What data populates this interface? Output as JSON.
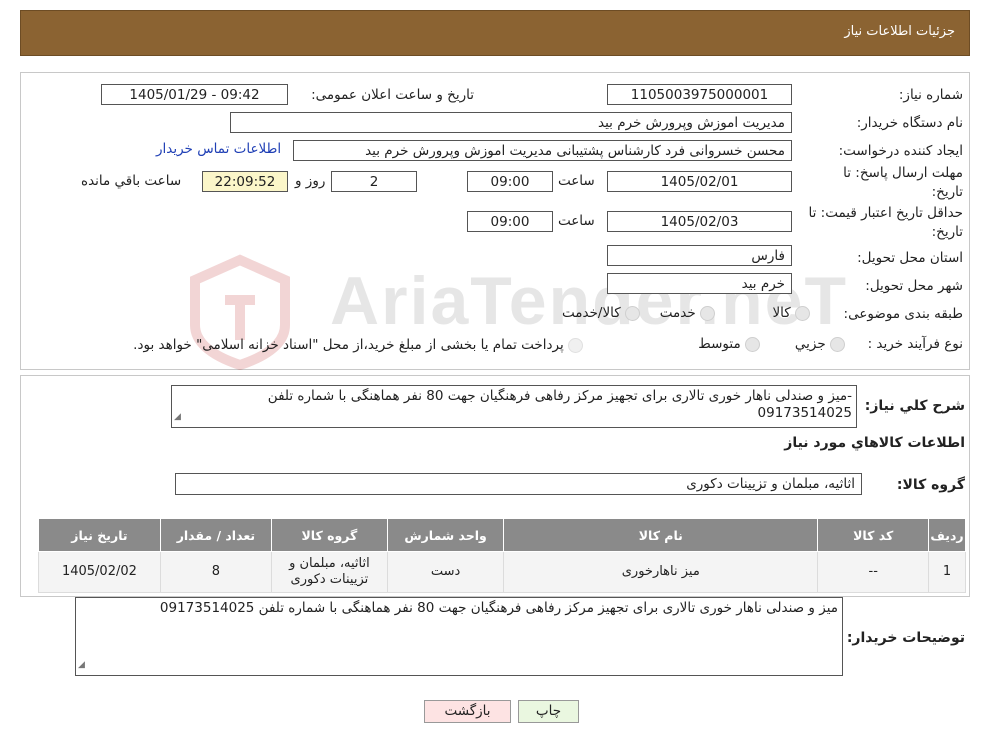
{
  "header": {
    "title": "جزئیات اطلاعات نیاز"
  },
  "form": {
    "need_number_label": "شماره نیاز:",
    "need_number": "1105003975000001",
    "announce_label": "تاریخ و ساعت اعلان عمومی:",
    "announce_value": "1405/01/29 - 09:42",
    "buyer_org_label": "نام دستگاه خریدار:",
    "buyer_org": "مدیریت اموزش وپرورش خرم بید",
    "creator_label": "ایجاد کننده درخواست:",
    "creator": "محسن خسروانی فرد کارشناس پشتیبانی مدیریت اموزش وپرورش خرم بید",
    "contact_link": "اطلاعات تماس خریدار",
    "deadline_label_1": "مهلت ارسال پاسخ: تا",
    "deadline_label_2": "تاریخ:",
    "deadline_date": "1405/02/01",
    "hour_label": "ساعت",
    "deadline_time": "09:00",
    "days_value": "2",
    "days_label": "روز و",
    "remaining_time": "22:09:52",
    "remaining_label": "ساعت باقي مانده",
    "validity_label_1": "حداقل تاریخ اعتبار قیمت: تا",
    "validity_label_2": "تاریخ:",
    "validity_date": "1405/02/03",
    "validity_time": "09:00",
    "province_label": "استان محل تحویل:",
    "province": "فارس",
    "city_label": "شهر محل تحویل:",
    "city": "خرم بید",
    "category_label": "طبقه بندی موضوعی:",
    "category_options": [
      "کالا",
      "خدمت",
      "کالا/خدمت"
    ],
    "process_label": "نوع فرآیند خرید :",
    "process_options": [
      "جزیي",
      "متوسط"
    ],
    "process_note": "پرداخت تمام یا بخشی از مبلغ خرید،از محل \"اسناد خزانه اسلامی\" خواهد بود."
  },
  "description": {
    "label": "شرح کلي نياز:",
    "text": "-میز و صندلی ناهار خوری تالاری برای تجهیز مرکز رفاهی فرهنگیان جهت 80 نفر هماهنگی با شماره تلفن 09173514025"
  },
  "goods": {
    "section_title": "اطلاعات کالاهاي مورد نياز",
    "group_label": "گروه کالا:",
    "group_value": "اثاثیه، مبلمان و تزیینات دکوری",
    "columns": [
      "رديف",
      "کد کالا",
      "نام کالا",
      "واحد شمارش",
      "گروه کالا",
      "تعداد / مقدار",
      "تاريخ نياز"
    ],
    "row": {
      "index": "1",
      "code": "--",
      "name": "میز ناهارخوری",
      "unit": "دست",
      "group": "اثاثیه، مبلمان و تزیینات دکوری",
      "qty": "8",
      "date": "1405/02/02"
    }
  },
  "buyer_notes": {
    "label": "توضیحات خریدار:",
    "text": "میز و صندلی ناهار خوری تالاری برای تجهیز مرکز رفاهی فرهنگیان جهت 80 نفر هماهنگی با شماره تلفن 09173514025"
  },
  "buttons": {
    "print": "چاپ",
    "back": "بازگشت"
  },
  "watermark": {
    "text": "AriaTender.neT"
  },
  "colors": {
    "header_bg": "#8B6332",
    "link": "#1f3fb5",
    "remaining_bg": "#fbf6c9",
    "back_btn_bg": "#fde3e3",
    "print_btn_bg": "#eaf7e0"
  }
}
